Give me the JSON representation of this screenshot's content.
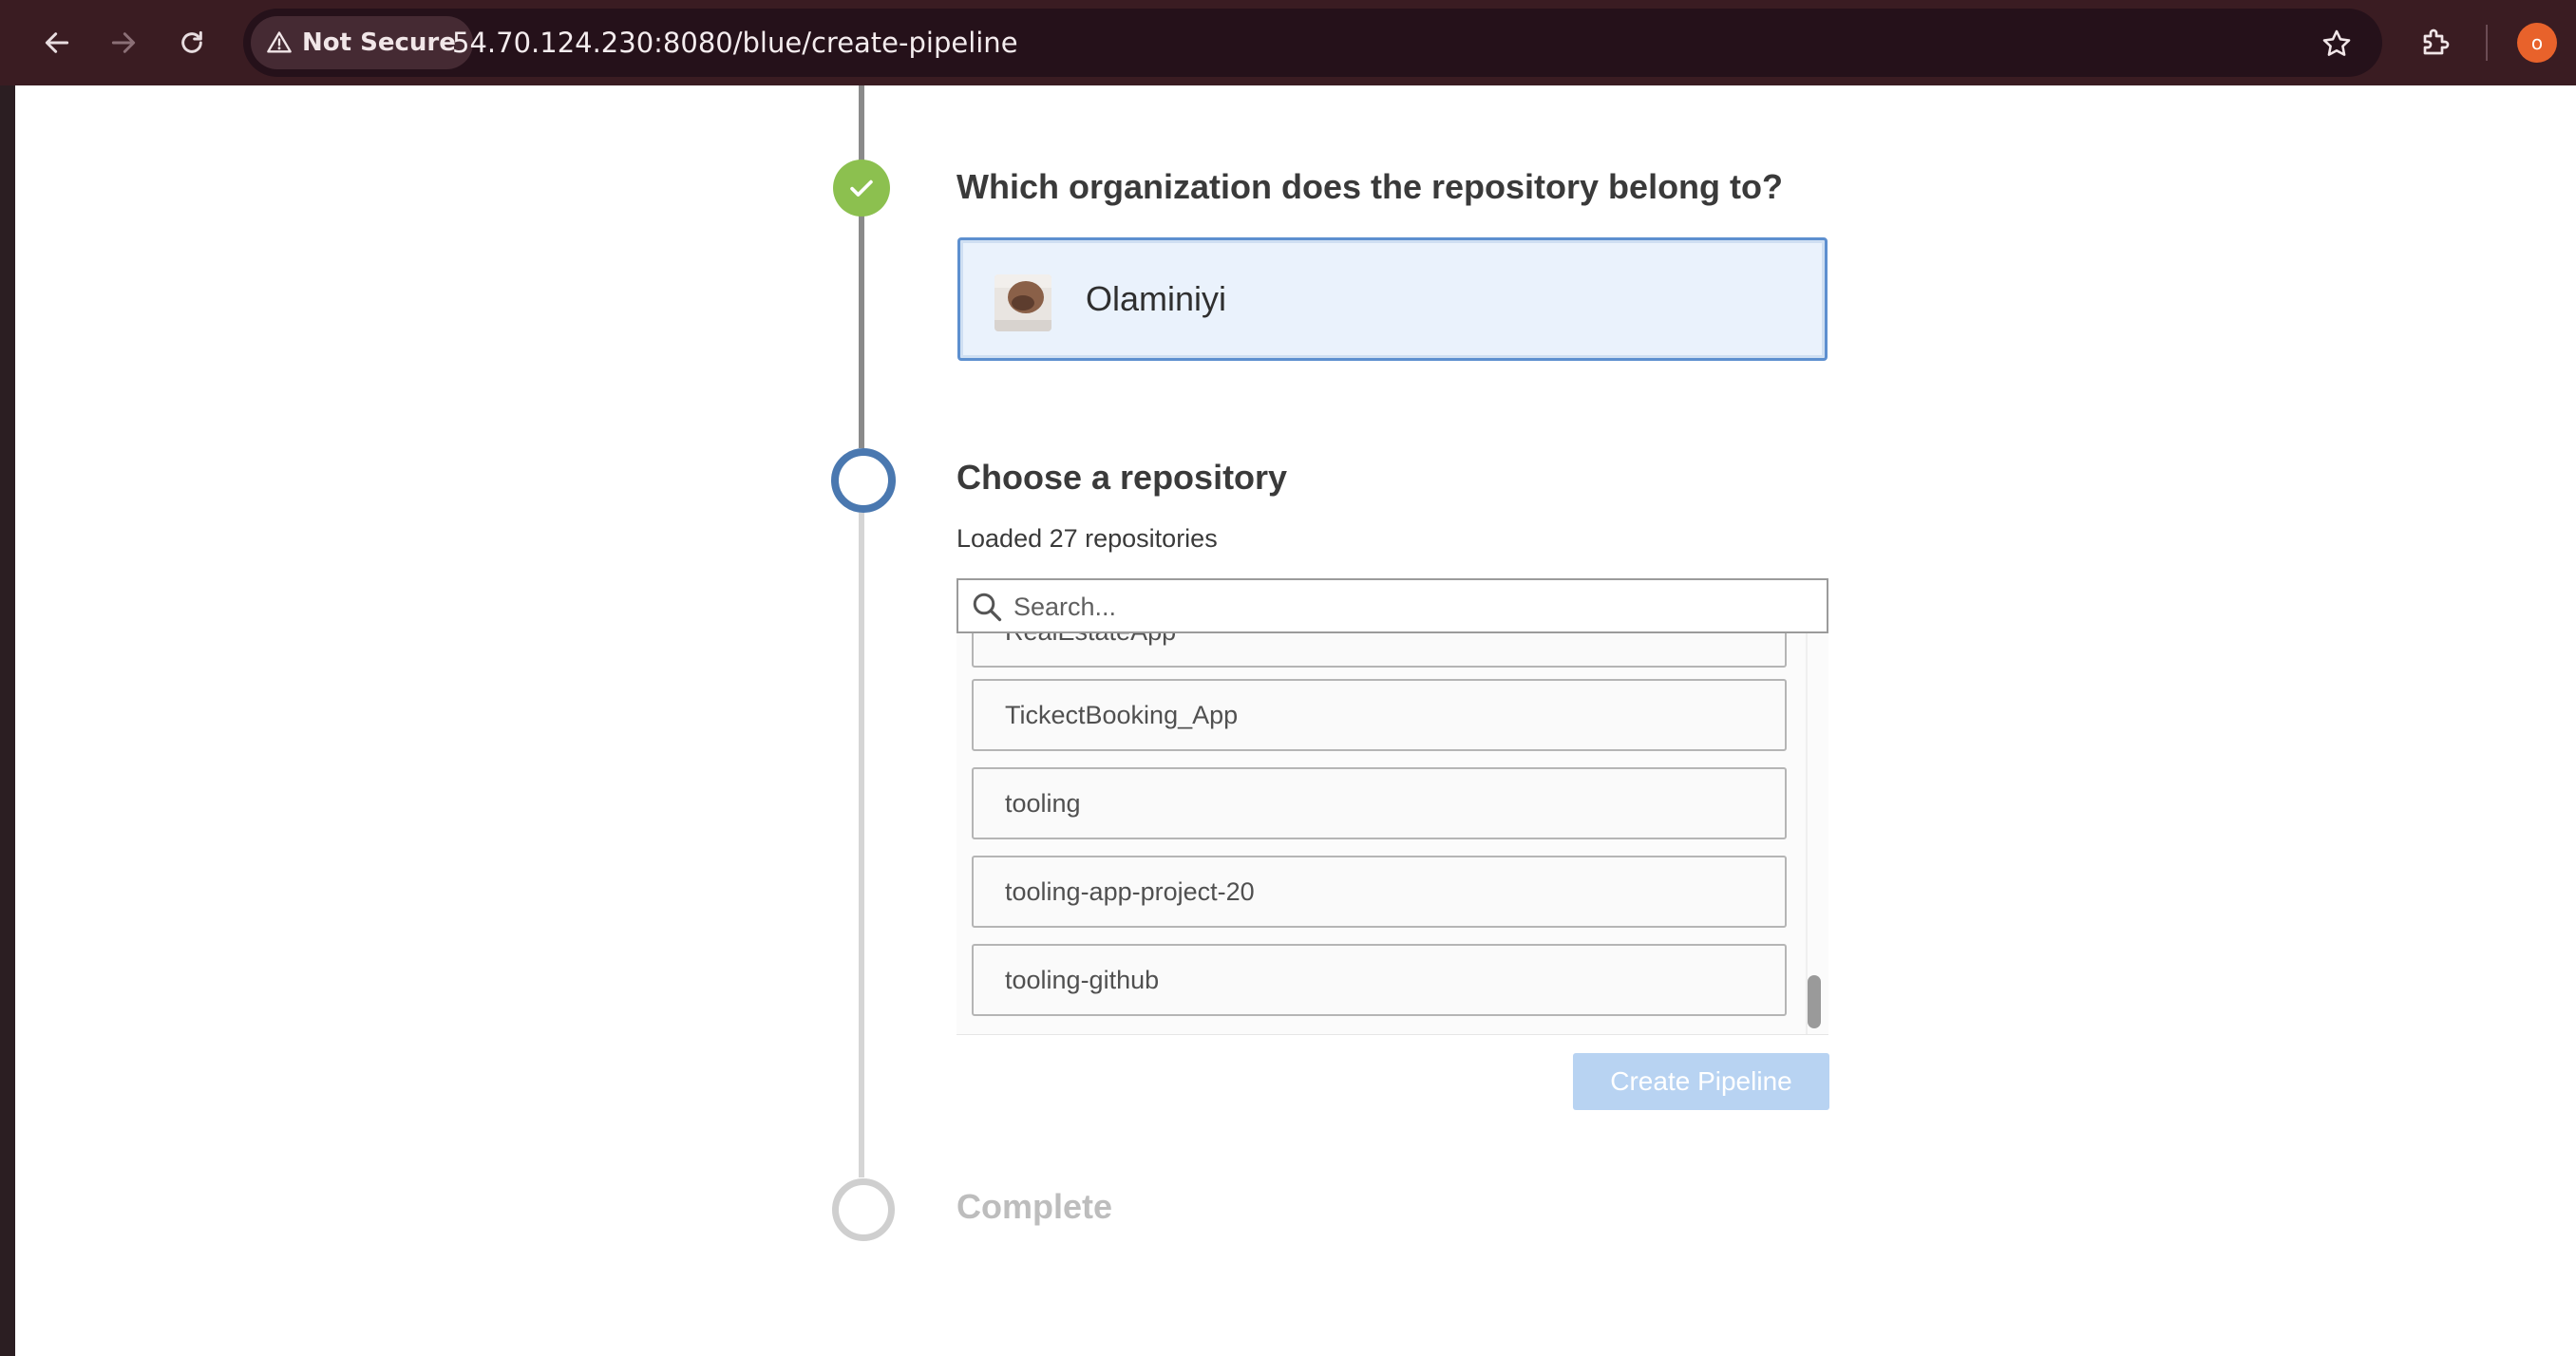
{
  "browser": {
    "security_label": "Not Secure",
    "url": "54.70.124.230:8080/blue/create-pipeline",
    "profile_initial": "o"
  },
  "steps": {
    "organization": {
      "title": "Which organization does the repository belong to?",
      "selected_org": "Olaminiyi",
      "status": "complete"
    },
    "repository": {
      "title": "Choose a repository",
      "loaded_text": "Loaded 27 repositories",
      "search_placeholder": "Search...",
      "repos": [
        {
          "name": "RealEstateApp"
        },
        {
          "name": "TickectBooking_App"
        },
        {
          "name": "tooling"
        },
        {
          "name": "tooling-app-project-20"
        },
        {
          "name": "tooling-github"
        }
      ],
      "create_button": "Create Pipeline",
      "status": "active"
    },
    "complete": {
      "title": "Complete",
      "status": "pending"
    }
  },
  "colors": {
    "chrome_bg": "#3a1c22",
    "check_green": "#8cc04f",
    "active_blue": "#4a78b0",
    "selected_bg": "#eaf2fc",
    "button_disabled": "#b8d3f2"
  }
}
